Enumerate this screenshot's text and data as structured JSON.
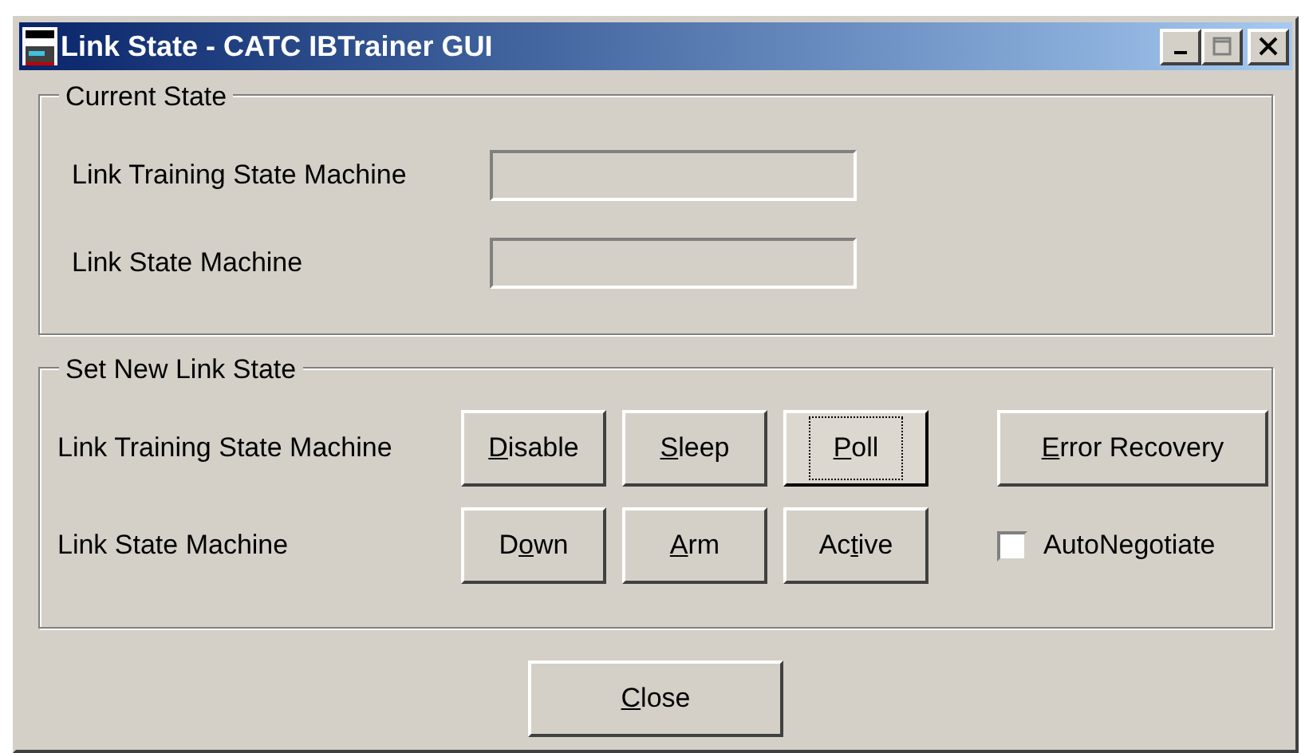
{
  "window": {
    "title": "Link State - CATC IBTrainer GUI"
  },
  "current_state": {
    "title": "Current State",
    "fields": [
      {
        "label": "Link Training State Machine"
      },
      {
        "label": "Link State Machine"
      }
    ]
  },
  "set_new_link_state": {
    "title": "Set New Link State",
    "rows": [
      {
        "label": "Link Training State Machine",
        "buttons": [
          {
            "label": [
              {
                "text": "D",
                "underlined": true
              },
              {
                "text": "isable",
                "underlined": false
              }
            ],
            "focused": false
          },
          {
            "label": [
              {
                "text": "S",
                "underlined": true
              },
              {
                "text": "leep",
                "underlined": false
              }
            ],
            "focused": false
          },
          {
            "label": [
              {
                "text": "P",
                "underlined": true
              },
              {
                "text": "oll",
                "underlined": false
              }
            ],
            "focused": true
          }
        ],
        "extra": {
          "kind": "button",
          "label": [
            {
              "text": "E",
              "underlined": true
            },
            {
              "text": "rror Recovery",
              "underlined": false
            }
          ],
          "focused": false
        }
      },
      {
        "label": "Link State Machine",
        "buttons": [
          {
            "label": [
              {
                "text": "D",
                "underlined": false
              },
              {
                "text": "o",
                "underlined": true
              },
              {
                "text": "wn",
                "underlined": false
              }
            ],
            "focused": false
          },
          {
            "label": [
              {
                "text": "A",
                "underlined": true
              },
              {
                "text": "rm",
                "underlined": false
              }
            ],
            "focused": false
          },
          {
            "label": [
              {
                "text": "Ac",
                "underlined": false
              },
              {
                "text": "t",
                "underlined": true
              },
              {
                "text": "ive",
                "underlined": false
              }
            ],
            "focused": false
          }
        ],
        "extra": {
          "kind": "checkbox",
          "label": "AutoNegotiate",
          "checked": false
        }
      }
    ]
  },
  "close_button": {
    "label": [
      {
        "text": "C",
        "underlined": true
      },
      {
        "text": "lose",
        "underlined": false
      }
    ],
    "focused": false
  }
}
